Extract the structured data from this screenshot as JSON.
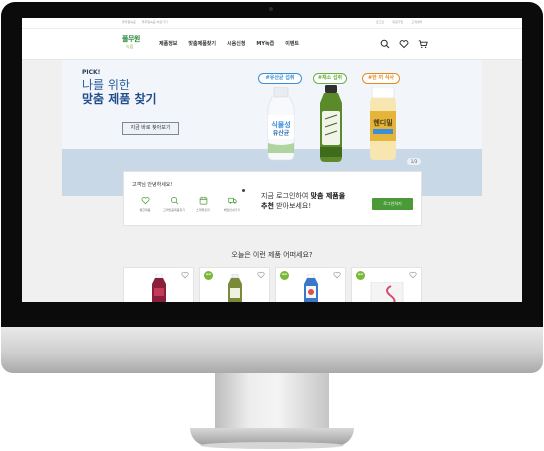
{
  "topbar": {
    "left": [
      "풀무원녹즙",
      "풀무원녹즙 바로가기"
    ],
    "right": [
      "로그인",
      "회원가입",
      "고객센터"
    ]
  },
  "brand": {
    "logo_top": "풀무원",
    "logo_bottom": "녹즙"
  },
  "menu": [
    "제품정보",
    "맞춤제품찾기",
    "시음신청",
    "MY녹즙",
    "이벤트"
  ],
  "nav_icons": [
    "search-icon",
    "heart-icon",
    "cart-icon"
  ],
  "hero": {
    "pick": "PICK!",
    "title_line1": "나를 위한",
    "title_line2": "맞춤 제품 찾기",
    "button": "지금 바로 찾아보기",
    "tags": [
      "#유산균 섭취",
      "#채소 섭취",
      "#한 끼 식사"
    ],
    "bottles": [
      {
        "label": "식물성",
        "sub": "유산균",
        "color": "#3b8fd6"
      },
      {
        "label": "",
        "sub": "",
        "color": "#5a8a2a"
      },
      {
        "label": "헨디밀",
        "sub": "",
        "color": "#e5b43a"
      }
    ],
    "pager": "1/3"
  },
  "login_card": {
    "greeting": "고객님 안녕하세요!",
    "quick_links": [
      {
        "icon": "heart-outline-icon",
        "label": "찜한제품"
      },
      {
        "icon": "search-doc-icon",
        "label": "고객맞춤제품찾기"
      },
      {
        "icon": "calendar-icon",
        "label": "스케줄관리"
      },
      {
        "icon": "delivery-truck-icon",
        "label": "배달안내가기"
      }
    ],
    "message_line1": "지금 로그인하여 ",
    "message_bold1": "맞춤 제품을",
    "message_bold2": "추천",
    "message_line2": " 받아보세요!",
    "button": "로그인하기"
  },
  "recommend": {
    "title": "오늘은 이런 제품 어떠세요?",
    "cards": [
      {
        "new": false,
        "badge": "",
        "color": "#8a1f3c"
      },
      {
        "new": true,
        "badge": "NEW",
        "color": "#7b8a3a"
      },
      {
        "new": true,
        "badge": "NEW",
        "color": "#3a78c7"
      },
      {
        "new": true,
        "badge": "NEW",
        "color": "#e8e8e8"
      }
    ]
  },
  "colors": {
    "brand_green": "#4a9a38",
    "hero_blue": "#2c5c99",
    "hero_bottom": "#c9d8e7"
  }
}
